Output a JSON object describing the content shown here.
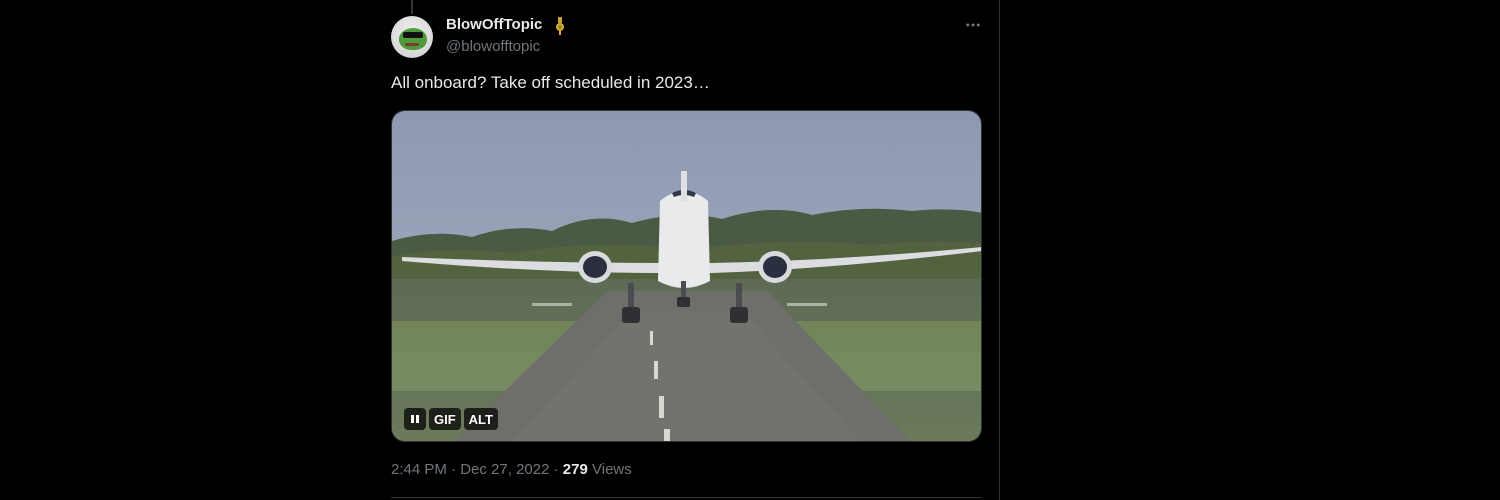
{
  "tweet": {
    "author": {
      "display_name": "BlowOffTopic",
      "handle": "@blowofftopic",
      "badge_icon": "military-medal-icon",
      "avatar_icon": "frog-sunglasses-avatar"
    },
    "text": "All onboard? Take off scheduled in 2023…",
    "media": {
      "type": "gif",
      "controls": {
        "pause_icon": "pause-icon",
        "gif_label": "GIF",
        "alt_label": "ALT"
      }
    },
    "meta": {
      "time": "2:44 PM",
      "separator": "·",
      "date": "Dec 27, 2022",
      "views_count": "279",
      "views_label": "Views"
    },
    "more_icon": "more-horizontal-icon"
  },
  "colors": {
    "background": "#000000",
    "text_primary": "#e7e9ea",
    "text_secondary": "#71767b",
    "border": "#2f3336"
  }
}
